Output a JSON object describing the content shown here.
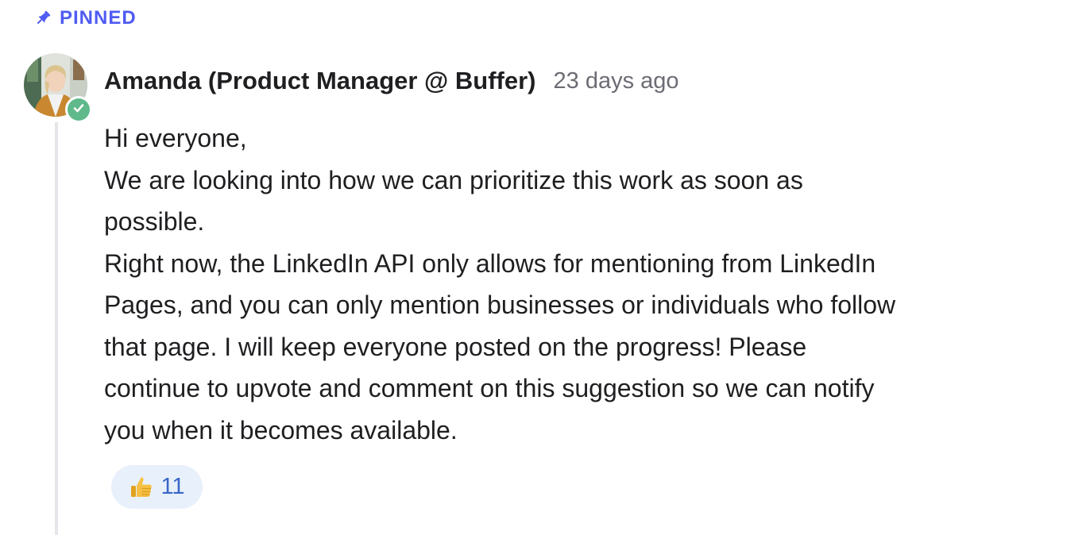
{
  "pinned": {
    "label": "PINNED",
    "icon": "pin-icon",
    "color": "#4f5bf2"
  },
  "comment": {
    "author": "Amanda (Product Manager @ Buffer)",
    "timestamp": "23 days ago",
    "verified": true,
    "verified_color": "#5fb98a",
    "body_lines": [
      "Hi everyone,",
      "We are looking into how we can prioritize this work as soon as",
      "possible.",
      "Right now, the LinkedIn API only allows for mentioning from LinkedIn",
      "Pages, and you can only mention businesses or individuals who follow",
      "that page. I will keep everyone posted on the progress! Please",
      "continue to upvote and comment on this suggestion so we can notify",
      "you when it becomes available."
    ],
    "reaction": {
      "icon": "thumbs-up-icon",
      "count": "11",
      "background": "#e8f0fb"
    }
  }
}
